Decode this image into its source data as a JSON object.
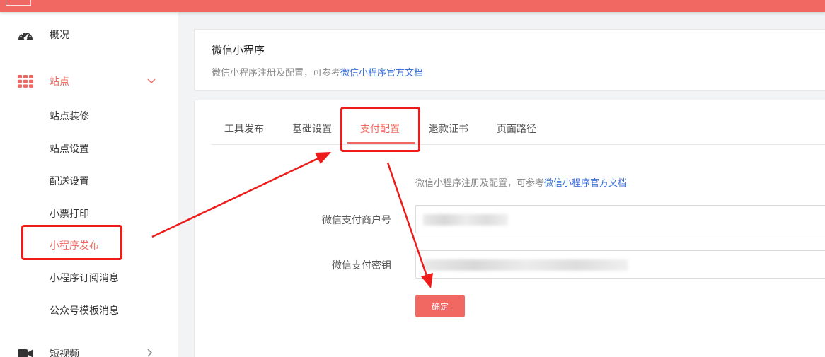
{
  "sidebar": {
    "items": [
      {
        "label": "概况",
        "icon": "dashboard-icon"
      },
      {
        "label": "站点",
        "icon": "grid-icon",
        "expanded": true,
        "active": true
      },
      {
        "label": "短视频",
        "icon": "video-icon"
      }
    ],
    "subitems": [
      {
        "label": "站点装修"
      },
      {
        "label": "站点设置"
      },
      {
        "label": "配送设置"
      },
      {
        "label": "小票打印"
      },
      {
        "label": "小程序发布",
        "active": true
      },
      {
        "label": "小程序订阅消息"
      },
      {
        "label": "公众号模板消息"
      }
    ]
  },
  "header_card": {
    "title": "微信小程序",
    "desc_prefix": "微信小程序注册及配置，可参考",
    "desc_link": "微信小程序官方文档"
  },
  "tabs": [
    {
      "label": "工具发布"
    },
    {
      "label": "基础设置"
    },
    {
      "label": "支付配置",
      "active": true
    },
    {
      "label": "退款证书"
    },
    {
      "label": "页面路径"
    }
  ],
  "form": {
    "desc_prefix": "微信小程序注册及配置，可参考",
    "desc_link": "微信小程序官方文档",
    "merchant_id_label": "微信支付商户号",
    "secret_key_label": "微信支付密钥",
    "confirm_label": "确定"
  },
  "colors": {
    "accent": "#f16863",
    "link": "#3a6fd8",
    "annotation": "#ee1b1b"
  }
}
